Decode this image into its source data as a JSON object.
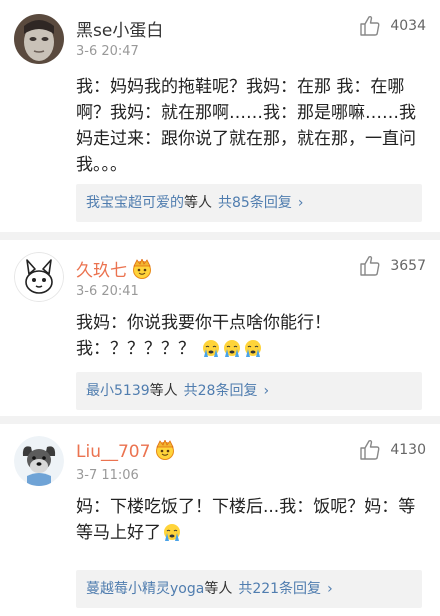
{
  "comments": [
    {
      "username": "黑se小蛋白",
      "time": "3-6 20:47",
      "likes": "4034",
      "text": "我：妈妈我的拖鞋呢？我妈：在那 我：在哪啊？我妈：就在那啊……我：那是哪嘛……我妈走过来：跟你说了就在那，就在那，一直问 我。。。",
      "reply_users": "我宝宝超可爱的",
      "reply_suffix": "等人",
      "reply_count": "共85条回复",
      "reply_arrow": "›"
    },
    {
      "username": "久玖七",
      "time": "3-6 20:41",
      "likes": "3657",
      "text_line1": "我妈：你说我要你干点啥你能行！",
      "text_line2": "我：？？？？？",
      "reply_users": "最小5139",
      "reply_suffix": "等人",
      "reply_count": "共28条回复",
      "reply_arrow": "›"
    },
    {
      "username": "Liu__707",
      "time": "3-7 11:06",
      "likes": "4130",
      "text": "妈：下楼吃饭了！下楼后...我：饭呢？妈：等等马上好了",
      "reply_users": "蔓越莓小精灵yoga",
      "reply_suffix": "等人",
      "reply_count": "共221条回复",
      "reply_arrow": "›"
    }
  ],
  "icons": {
    "like": "thumbs-up-icon",
    "crown": "vip-crown-icon",
    "emoji": "crying-face-emoji"
  },
  "colors": {
    "vip_name": "#eb7350",
    "link": "#507daf",
    "muted": "#999999",
    "reply_bg": "#f2f2f2"
  }
}
